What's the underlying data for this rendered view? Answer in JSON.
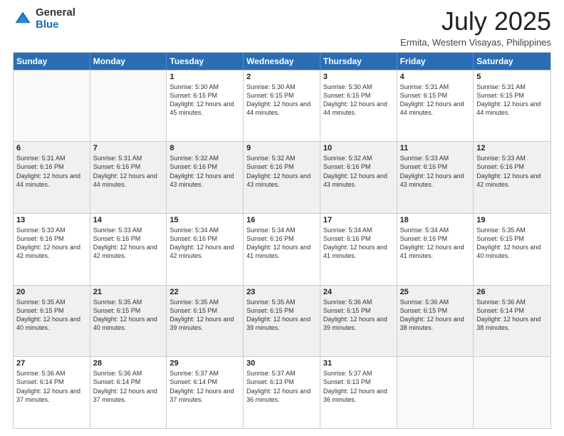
{
  "logo": {
    "general": "General",
    "blue": "Blue"
  },
  "title": "July 2025",
  "subtitle": "Ermita, Western Visayas, Philippines",
  "header_days": [
    "Sunday",
    "Monday",
    "Tuesday",
    "Wednesday",
    "Thursday",
    "Friday",
    "Saturday"
  ],
  "weeks": [
    [
      {
        "day": "",
        "sunrise": "",
        "sunset": "",
        "daylight": "",
        "empty": true
      },
      {
        "day": "",
        "sunrise": "",
        "sunset": "",
        "daylight": "",
        "empty": true
      },
      {
        "day": "1",
        "sunrise": "Sunrise: 5:30 AM",
        "sunset": "Sunset: 6:15 PM",
        "daylight": "Daylight: 12 hours and 45 minutes.",
        "empty": false
      },
      {
        "day": "2",
        "sunrise": "Sunrise: 5:30 AM",
        "sunset": "Sunset: 6:15 PM",
        "daylight": "Daylight: 12 hours and 44 minutes.",
        "empty": false
      },
      {
        "day": "3",
        "sunrise": "Sunrise: 5:30 AM",
        "sunset": "Sunset: 6:15 PM",
        "daylight": "Daylight: 12 hours and 44 minutes.",
        "empty": false
      },
      {
        "day": "4",
        "sunrise": "Sunrise: 5:31 AM",
        "sunset": "Sunset: 6:15 PM",
        "daylight": "Daylight: 12 hours and 44 minutes.",
        "empty": false
      },
      {
        "day": "5",
        "sunrise": "Sunrise: 5:31 AM",
        "sunset": "Sunset: 6:15 PM",
        "daylight": "Daylight: 12 hours and 44 minutes.",
        "empty": false
      }
    ],
    [
      {
        "day": "6",
        "sunrise": "Sunrise: 5:31 AM",
        "sunset": "Sunset: 6:16 PM",
        "daylight": "Daylight: 12 hours and 44 minutes.",
        "empty": false
      },
      {
        "day": "7",
        "sunrise": "Sunrise: 5:31 AM",
        "sunset": "Sunset: 6:16 PM",
        "daylight": "Daylight: 12 hours and 44 minutes.",
        "empty": false
      },
      {
        "day": "8",
        "sunrise": "Sunrise: 5:32 AM",
        "sunset": "Sunset: 6:16 PM",
        "daylight": "Daylight: 12 hours and 43 minutes.",
        "empty": false
      },
      {
        "day": "9",
        "sunrise": "Sunrise: 5:32 AM",
        "sunset": "Sunset: 6:16 PM",
        "daylight": "Daylight: 12 hours and 43 minutes.",
        "empty": false
      },
      {
        "day": "10",
        "sunrise": "Sunrise: 5:32 AM",
        "sunset": "Sunset: 6:16 PM",
        "daylight": "Daylight: 12 hours and 43 minutes.",
        "empty": false
      },
      {
        "day": "11",
        "sunrise": "Sunrise: 5:33 AM",
        "sunset": "Sunset: 6:16 PM",
        "daylight": "Daylight: 12 hours and 43 minutes.",
        "empty": false
      },
      {
        "day": "12",
        "sunrise": "Sunrise: 5:33 AM",
        "sunset": "Sunset: 6:16 PM",
        "daylight": "Daylight: 12 hours and 42 minutes.",
        "empty": false
      }
    ],
    [
      {
        "day": "13",
        "sunrise": "Sunrise: 5:33 AM",
        "sunset": "Sunset: 6:16 PM",
        "daylight": "Daylight: 12 hours and 42 minutes.",
        "empty": false
      },
      {
        "day": "14",
        "sunrise": "Sunrise: 5:33 AM",
        "sunset": "Sunset: 6:16 PM",
        "daylight": "Daylight: 12 hours and 42 minutes.",
        "empty": false
      },
      {
        "day": "15",
        "sunrise": "Sunrise: 5:34 AM",
        "sunset": "Sunset: 6:16 PM",
        "daylight": "Daylight: 12 hours and 42 minutes.",
        "empty": false
      },
      {
        "day": "16",
        "sunrise": "Sunrise: 5:34 AM",
        "sunset": "Sunset: 6:16 PM",
        "daylight": "Daylight: 12 hours and 41 minutes.",
        "empty": false
      },
      {
        "day": "17",
        "sunrise": "Sunrise: 5:34 AM",
        "sunset": "Sunset: 6:16 PM",
        "daylight": "Daylight: 12 hours and 41 minutes.",
        "empty": false
      },
      {
        "day": "18",
        "sunrise": "Sunrise: 5:34 AM",
        "sunset": "Sunset: 6:16 PM",
        "daylight": "Daylight: 12 hours and 41 minutes.",
        "empty": false
      },
      {
        "day": "19",
        "sunrise": "Sunrise: 5:35 AM",
        "sunset": "Sunset: 6:15 PM",
        "daylight": "Daylight: 12 hours and 40 minutes.",
        "empty": false
      }
    ],
    [
      {
        "day": "20",
        "sunrise": "Sunrise: 5:35 AM",
        "sunset": "Sunset: 6:15 PM",
        "daylight": "Daylight: 12 hours and 40 minutes.",
        "empty": false
      },
      {
        "day": "21",
        "sunrise": "Sunrise: 5:35 AM",
        "sunset": "Sunset: 6:15 PM",
        "daylight": "Daylight: 12 hours and 40 minutes.",
        "empty": false
      },
      {
        "day": "22",
        "sunrise": "Sunrise: 5:35 AM",
        "sunset": "Sunset: 6:15 PM",
        "daylight": "Daylight: 12 hours and 39 minutes.",
        "empty": false
      },
      {
        "day": "23",
        "sunrise": "Sunrise: 5:35 AM",
        "sunset": "Sunset: 6:15 PM",
        "daylight": "Daylight: 12 hours and 39 minutes.",
        "empty": false
      },
      {
        "day": "24",
        "sunrise": "Sunrise: 5:36 AM",
        "sunset": "Sunset: 6:15 PM",
        "daylight": "Daylight: 12 hours and 39 minutes.",
        "empty": false
      },
      {
        "day": "25",
        "sunrise": "Sunrise: 5:36 AM",
        "sunset": "Sunset: 6:15 PM",
        "daylight": "Daylight: 12 hours and 38 minutes.",
        "empty": false
      },
      {
        "day": "26",
        "sunrise": "Sunrise: 5:36 AM",
        "sunset": "Sunset: 6:14 PM",
        "daylight": "Daylight: 12 hours and 38 minutes.",
        "empty": false
      }
    ],
    [
      {
        "day": "27",
        "sunrise": "Sunrise: 5:36 AM",
        "sunset": "Sunset: 6:14 PM",
        "daylight": "Daylight: 12 hours and 37 minutes.",
        "empty": false
      },
      {
        "day": "28",
        "sunrise": "Sunrise: 5:36 AM",
        "sunset": "Sunset: 6:14 PM",
        "daylight": "Daylight: 12 hours and 37 minutes.",
        "empty": false
      },
      {
        "day": "29",
        "sunrise": "Sunrise: 5:37 AM",
        "sunset": "Sunset: 6:14 PM",
        "daylight": "Daylight: 12 hours and 37 minutes.",
        "empty": false
      },
      {
        "day": "30",
        "sunrise": "Sunrise: 5:37 AM",
        "sunset": "Sunset: 6:13 PM",
        "daylight": "Daylight: 12 hours and 36 minutes.",
        "empty": false
      },
      {
        "day": "31",
        "sunrise": "Sunrise: 5:37 AM",
        "sunset": "Sunset: 6:13 PM",
        "daylight": "Daylight: 12 hours and 36 minutes.",
        "empty": false
      },
      {
        "day": "",
        "sunrise": "",
        "sunset": "",
        "daylight": "",
        "empty": true
      },
      {
        "day": "",
        "sunrise": "",
        "sunset": "",
        "daylight": "",
        "empty": true
      }
    ]
  ]
}
